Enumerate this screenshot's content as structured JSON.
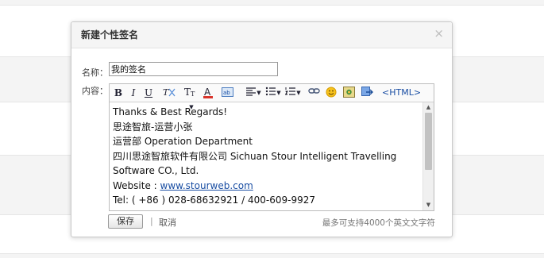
{
  "dialog": {
    "title": "新建个性签名",
    "close_symbol": "×",
    "name_label": "名称：",
    "name_value": "我的签名",
    "content_label": "内容：",
    "toolbar": {
      "bold": "B",
      "italic": "I",
      "underline": "U",
      "html_label": "<HTML>",
      "icons": [
        "bold-icon",
        "italic-icon",
        "underline-icon",
        "clear-format-icon",
        "font-size-icon",
        "font-color-icon",
        "highlight-icon",
        "align-icon",
        "unordered-list-icon",
        "ordered-list-icon",
        "link-icon",
        "emoticon-icon",
        "image-icon",
        "insert-flash-icon"
      ]
    },
    "content_lines": [
      "Thanks & Best Regards!",
      "思途智旅-运营小张",
      "运营部  Operation Department",
      "四川思途智旅软件有限公司 Sichuan Stour Intelligent Travelling",
      "Software CO., Ltd."
    ],
    "website_prefix": "Website : ",
    "website_link": "www.stourweb.com",
    "tel_line": "Tel: ( +86 ) 028-68632921 / 400-609-9927",
    "save_label": "保存",
    "separator": "|",
    "cancel_label": "取消",
    "limit_hint": "最多可支持4000个英文文字符"
  },
  "colors": {
    "link": "#1a4ea3",
    "header_bg": "#f5f5f5",
    "font_color_underline": "#d9342b"
  }
}
